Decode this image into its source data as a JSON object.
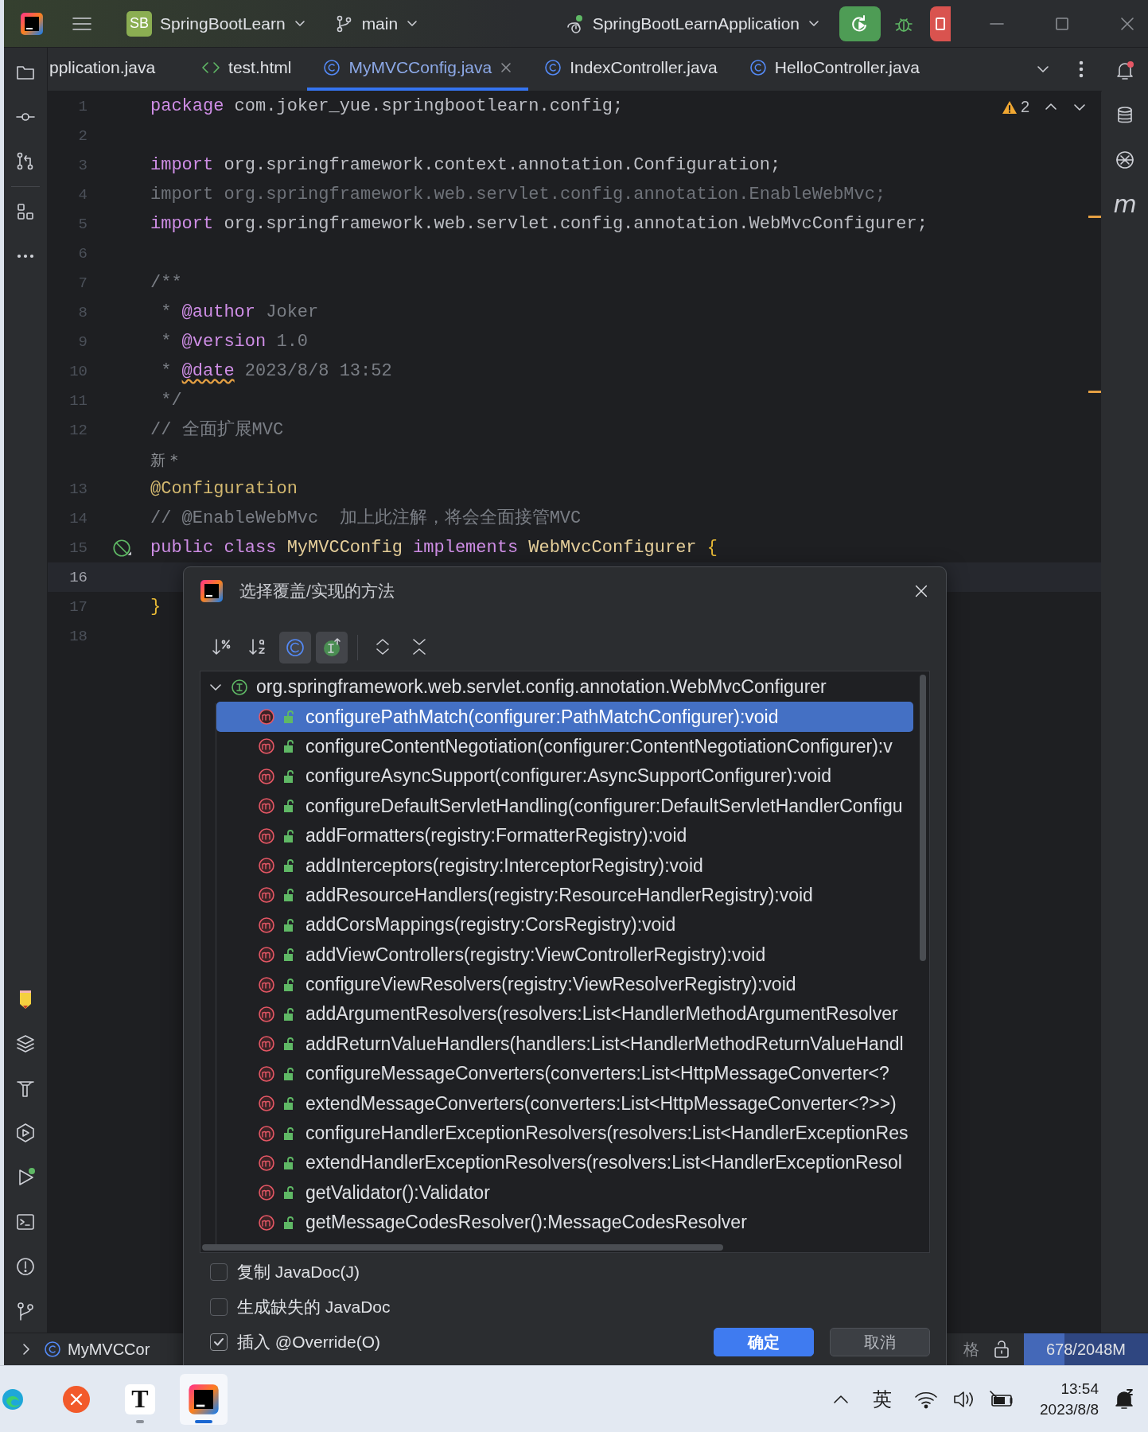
{
  "title_bar": {
    "project": {
      "badge": "SB",
      "name": "SpringBootLearn"
    },
    "branch": "main",
    "run_config": "SpringBootLearnApplication"
  },
  "tabs": [
    {
      "label": "pplication.java",
      "kind": "none",
      "selected": false,
      "closable": false
    },
    {
      "label": "test.html",
      "kind": "html",
      "selected": false,
      "closable": false
    },
    {
      "label": "MyMVCConfig.java",
      "kind": "class",
      "selected": true,
      "closable": true
    },
    {
      "label": "IndexController.java",
      "kind": "class",
      "selected": false,
      "closable": false
    },
    {
      "label": "HelloController.java",
      "kind": "class",
      "selected": false,
      "closable": false
    }
  ],
  "editor": {
    "warning_count": "2",
    "lines": [
      {
        "number": "1",
        "current": false,
        "tokens": [
          {
            "kind": "keyword",
            "text": "package"
          },
          {
            "kind": "plain",
            "text": " com.joker_yue.springbootlearn.config;"
          }
        ]
      },
      {
        "number": "2",
        "current": false
      },
      {
        "number": "3",
        "current": false,
        "tokens": [
          {
            "kind": "keyword",
            "text": "import"
          },
          {
            "kind": "plain",
            "text": " org.springframework.context.annotation.Configuration;"
          }
        ]
      },
      {
        "number": "4",
        "current": false,
        "tokens": [
          {
            "kind": "unused",
            "text": "import org.springframework.web.servlet.config.annotation.EnableWebMvc;"
          }
        ]
      },
      {
        "number": "5",
        "current": false,
        "tokens": [
          {
            "kind": "keyword",
            "text": "import"
          },
          {
            "kind": "plain",
            "text": " org.springframework.web.servlet.config.annotation.WebMvcConfigurer;"
          }
        ]
      },
      {
        "number": "6",
        "current": false
      },
      {
        "number": "7",
        "current": false,
        "tokens": [
          {
            "kind": "comment",
            "text": "/**"
          }
        ]
      },
      {
        "number": "8",
        "current": false,
        "tokens": [
          {
            "kind": "comment",
            "text": " * "
          },
          {
            "kind": "doctag",
            "text": "@author"
          },
          {
            "kind": "comment",
            "text": " Joker"
          }
        ]
      },
      {
        "number": "9",
        "current": false,
        "tokens": [
          {
            "kind": "comment",
            "text": " * "
          },
          {
            "kind": "doctag",
            "text": "@version"
          },
          {
            "kind": "comment",
            "text": " 1.0"
          }
        ]
      },
      {
        "number": "10",
        "current": false,
        "tokens": [
          {
            "kind": "comment",
            "text": " * "
          },
          {
            "kind": "doctag",
            "text": "@date",
            "warning": true
          },
          {
            "kind": "comment",
            "text": " 2023/8/8 13:52"
          }
        ]
      },
      {
        "number": "11",
        "current": false,
        "tokens": [
          {
            "kind": "comment",
            "text": " */"
          }
        ]
      },
      {
        "number": "12",
        "current": false,
        "tokens": [
          {
            "kind": "comment",
            "text": "// 全面扩展MVC"
          }
        ]
      },
      {
        "kind": "hint",
        "tokens": [
          {
            "kind": "hint",
            "text": "新 *"
          }
        ]
      },
      {
        "number": "13",
        "current": false,
        "tokens": [
          {
            "kind": "annotation",
            "text": "@Configuration"
          }
        ]
      },
      {
        "number": "14",
        "current": false,
        "tokens": [
          {
            "kind": "comment",
            "text": "// @EnableWebMvc  加上此注解，将会全面接管MVC"
          }
        ]
      },
      {
        "number": "15",
        "current": false,
        "implemented": true,
        "tokens": [
          {
            "kind": "keyword",
            "text": "public class "
          },
          {
            "kind": "classname",
            "text": "MyMVCConfig "
          },
          {
            "kind": "keyword",
            "text": "implements "
          },
          {
            "kind": "classname",
            "text": "WebMvcConfigurer "
          },
          {
            "kind": "brace",
            "text": "{"
          }
        ]
      },
      {
        "number": "16",
        "current": true
      },
      {
        "number": "17",
        "current": false,
        "tokens": [
          {
            "kind": "brace",
            "text": "}"
          }
        ]
      },
      {
        "number": "18",
        "current": false
      }
    ]
  },
  "right_toolbar": {
    "maven_label": "m"
  },
  "dialog": {
    "title": "选择覆盖/实现的方法",
    "toolbar": [
      {
        "kind": "sort-percent",
        "selected": false
      },
      {
        "kind": "sort-alpha",
        "selected": false
      },
      {
        "kind": "class",
        "selected": true
      },
      {
        "kind": "interface",
        "selected": true
      },
      {
        "kind": "expand",
        "selected": false
      },
      {
        "kind": "collapse",
        "selected": false
      }
    ],
    "tree": {
      "label": "org.springframework.web.servlet.config.annotation.WebMvcConfigurer",
      "expanded": true,
      "children": [
        {
          "label": "configurePathMatch(configurer:PathMatchConfigurer):void",
          "selected": true
        },
        {
          "label": "configureContentNegotiation(configurer:ContentNegotiationConfigurer):v",
          "selected": false
        },
        {
          "label": "configureAsyncSupport(configurer:AsyncSupportConfigurer):void",
          "selected": false
        },
        {
          "label": "configureDefaultServletHandling(configurer:DefaultServletHandlerConfigu",
          "selected": false
        },
        {
          "label": "addFormatters(registry:FormatterRegistry):void",
          "selected": false
        },
        {
          "label": "addInterceptors(registry:InterceptorRegistry):void",
          "selected": false
        },
        {
          "label": "addResourceHandlers(registry:ResourceHandlerRegistry):void",
          "selected": false
        },
        {
          "label": "addCorsMappings(registry:CorsRegistry):void",
          "selected": false
        },
        {
          "label": "addViewControllers(registry:ViewControllerRegistry):void",
          "selected": false
        },
        {
          "label": "configureViewResolvers(registry:ViewResolverRegistry):void",
          "selected": false
        },
        {
          "label": "addArgumentResolvers(resolvers:List<HandlerMethodArgumentResolver",
          "selected": false
        },
        {
          "label": "addReturnValueHandlers(handlers:List<HandlerMethodReturnValueHandl",
          "selected": false
        },
        {
          "label": "configureMessageConverters(converters:List<HttpMessageConverter<?",
          "selected": false
        },
        {
          "label": "extendMessageConverters(converters:List<HttpMessageConverter<?>>)",
          "selected": false
        },
        {
          "label": "configureHandlerExceptionResolvers(resolvers:List<HandlerExceptionRes",
          "selected": false
        },
        {
          "label": "extendHandlerExceptionResolvers(resolvers:List<HandlerExceptionResol",
          "selected": false
        },
        {
          "label": "getValidator():Validator",
          "selected": false
        },
        {
          "label": "getMessageCodesResolver():MessageCodesResolver",
          "selected": false
        }
      ]
    },
    "options": [
      {
        "label": "复制 JavaDoc(J)",
        "checked": false
      },
      {
        "label": "生成缺失的 JavaDoc",
        "checked": false
      },
      {
        "label": "插入 @Override(O)",
        "checked": true
      }
    ],
    "buttons": [
      {
        "label": "确定",
        "kind": "primary"
      },
      {
        "label": "取消",
        "kind": "secondary"
      }
    ]
  },
  "status_bar": {
    "breadcrumb": "MyMVCCor",
    "fragment": "格",
    "memory": {
      "reading": "678/2048M",
      "level": 0.33
    }
  },
  "taskbar": {
    "apps": [
      {
        "kind": "browser",
        "selected": false
      },
      {
        "kind": "close-app",
        "selected": false
      },
      {
        "kind": "text-app",
        "label": "T",
        "selected": false
      },
      {
        "kind": "ide",
        "selected": true
      }
    ],
    "input_method": "英",
    "time": "13:54",
    "date": "2023/8/8"
  }
}
